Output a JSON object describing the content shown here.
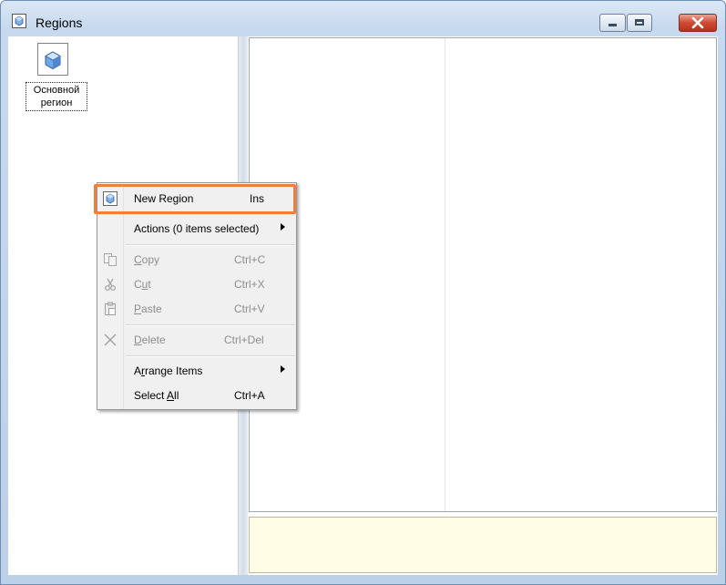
{
  "window": {
    "title": "Regions",
    "icon": "region-cube-icon",
    "controls": {
      "minimize": "minimize-icon",
      "maximize": "maximize-icon",
      "close": "close-icon"
    }
  },
  "left_pane": {
    "items": [
      {
        "label": "Основной регион",
        "icon": "region-cube-icon"
      }
    ]
  },
  "context_menu": {
    "items": [
      {
        "label": "New Region",
        "shortcut": "Ins",
        "icon": "region-cube-icon",
        "highlighted": true
      },
      {
        "label": "Actions (0 items selected)",
        "shortcut": "",
        "submenu": true
      },
      {
        "label": "Copy",
        "mnemonic": "C",
        "shortcut": "Ctrl+C",
        "icon": "copy-icon",
        "disabled": true
      },
      {
        "label": "Cut",
        "mnemonic": "u",
        "shortcut": "Ctrl+X",
        "icon": "scissors-icon",
        "disabled": true
      },
      {
        "label": "Paste",
        "mnemonic": "P",
        "shortcut": "Ctrl+V",
        "icon": "paste-icon",
        "disabled": true
      },
      {
        "label": "Delete",
        "mnemonic": "D",
        "shortcut": "Ctrl+Del",
        "icon": "delete-x-icon",
        "disabled": true
      },
      {
        "label": "Arrange Items",
        "mnemonic": "r",
        "shortcut": "",
        "submenu": true
      },
      {
        "label": "Select All",
        "mnemonic": "A",
        "shortcut": "Ctrl+A"
      }
    ]
  },
  "colors": {
    "highlight_border": "#ef7f3c",
    "info_panel_bg": "#fffde6",
    "close_button": "#cf4a33"
  }
}
